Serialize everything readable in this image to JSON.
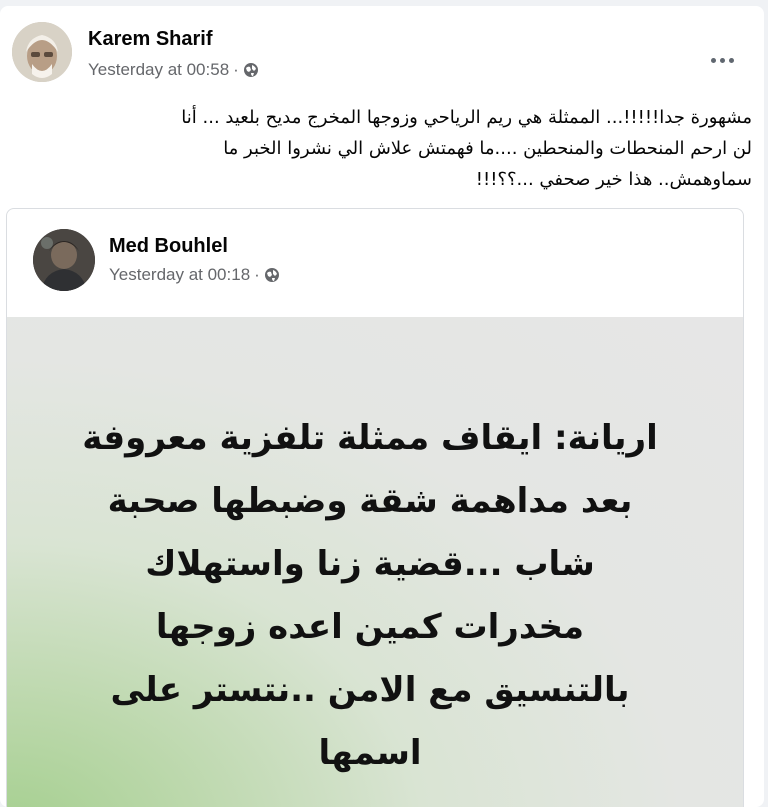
{
  "post": {
    "author": "Karem Sharif",
    "time": "Yesterday at 00:58",
    "separator": "·",
    "privacy_icon": "globe-icon",
    "more_icon": "more-options-icon",
    "text_lines": [
      "مشهورة جدا!!!!!...  الممثلة هي ريم الرياحي وزوجها المخرج  مديح بلعيد  ... أنا",
      "لن ارحم  المنحطات والمنحطين ....ما فهمتش علاش الي نشروا الخبر ما",
      "سماوهمش.. هذا خير صحفي  ...؟؟!!!"
    ]
  },
  "shared_post": {
    "author": "Med Bouhlel",
    "time": "Yesterday at 00:18",
    "separator": "·",
    "privacy_icon": "globe-icon",
    "image_text_lines": [
      "اريانة: ايقاف ممثلة تلفزية معروفة",
      "بعد مداهمة شقة وضبطها صحبة",
      "شاب ...قضية زنا واستهلاك",
      "مخدرات كمين اعده زوجها",
      "بالتنسيق مع الامن ..نتستر على",
      "اسمها"
    ],
    "background_colors": [
      "#a4cf8e",
      "#e6e6e6"
    ]
  }
}
